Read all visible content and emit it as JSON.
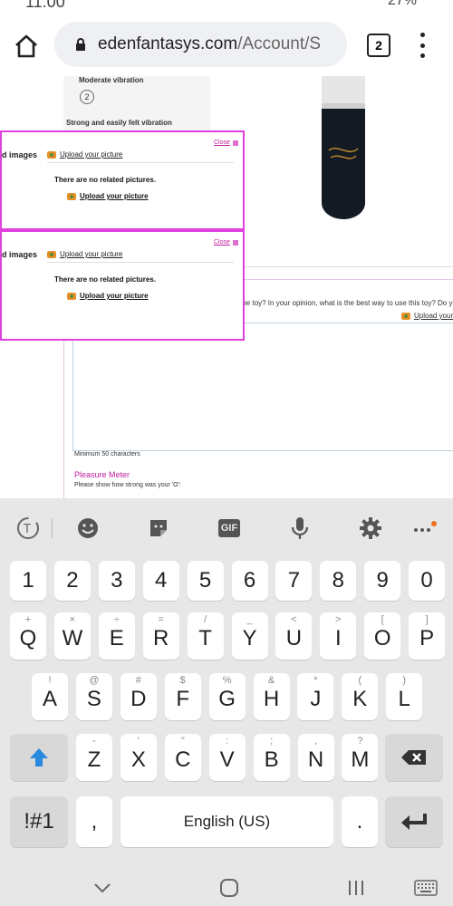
{
  "status": {
    "time": "11:00",
    "battery": "27%"
  },
  "browser": {
    "url_domain": "edenfantasys.com",
    "url_path": "/Account/S",
    "tab_count": "2"
  },
  "page": {
    "vibration_moderate": "Moderate vibration",
    "vibration_number": "2",
    "vibration_strong": "Strong and easily felt vibration",
    "question_text": "sed the toy? In your opinion, what is the best way to use this toy? Do you h",
    "upload_right": "Upload your",
    "min_chars": "Minimum 50 characters",
    "pleasure_title": "Pleasure Meter",
    "pleasure_sub": "Please show how strong was your 'O':"
  },
  "popups": [
    {
      "title": "d images",
      "upload": "Upload your picture",
      "close": "Close",
      "none": "There are no related pictures.",
      "upload2": "Upload your picture"
    },
    {
      "title": "d images",
      "upload": "Upload your picture",
      "close": "Close",
      "none": "There are no related pictures.",
      "upload2": "Upload your picture"
    }
  ],
  "keyboard": {
    "toolbar": [
      "text-tools-icon",
      "emoji-icon",
      "sticker-icon",
      "gif-icon",
      "mic-icon",
      "settings-icon",
      "more-icon"
    ],
    "gif_label": "GIF",
    "numbers": [
      "1",
      "2",
      "3",
      "4",
      "5",
      "6",
      "7",
      "8",
      "9",
      "0"
    ],
    "row1": [
      [
        "+",
        "Q"
      ],
      [
        "×",
        "W"
      ],
      [
        "÷",
        "E"
      ],
      [
        "=",
        "R"
      ],
      [
        "/",
        "T"
      ],
      [
        "_",
        "Y"
      ],
      [
        "<",
        "U"
      ],
      [
        ">",
        "I"
      ],
      [
        "[",
        "O"
      ],
      [
        "]",
        "P"
      ]
    ],
    "row2": [
      [
        "!",
        "A"
      ],
      [
        "@",
        "S"
      ],
      [
        "#",
        "D"
      ],
      [
        "$",
        "F"
      ],
      [
        "%",
        "G"
      ],
      [
        "&",
        "H"
      ],
      [
        "*",
        "J"
      ],
      [
        "(",
        "K"
      ],
      [
        ")",
        "L"
      ]
    ],
    "row3": [
      [
        "-",
        "Z"
      ],
      [
        "'",
        "X"
      ],
      [
        "\"",
        "C"
      ],
      [
        ":",
        "V"
      ],
      [
        ";",
        "B"
      ],
      [
        ",",
        "N"
      ],
      [
        "?",
        "M"
      ]
    ],
    "symbols_label": "!#1",
    "comma_label": ",",
    "space_label": "English (US)",
    "period_label": "."
  }
}
